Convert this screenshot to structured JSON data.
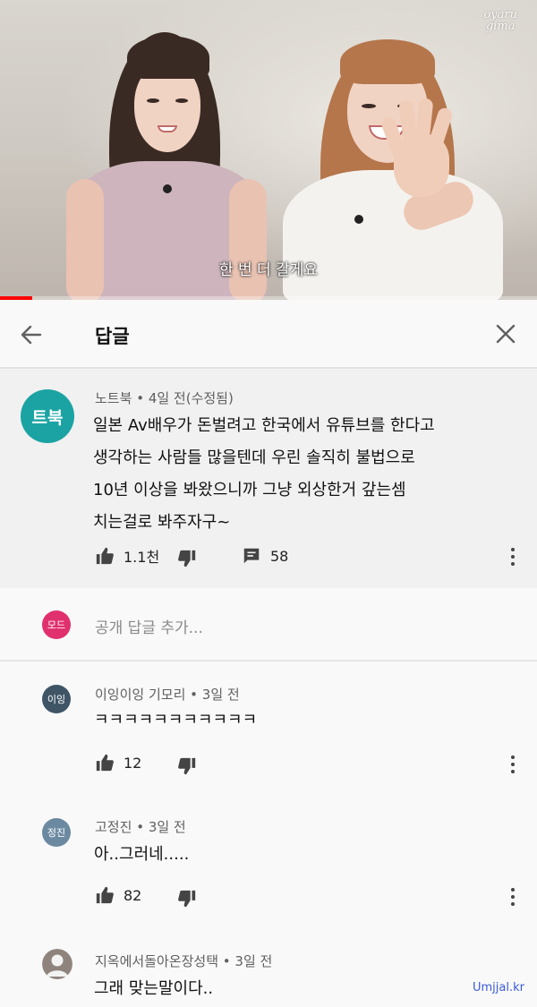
{
  "video": {
    "watermark_line1": "oyaru",
    "watermark_line2": "gima",
    "subtitle": "한 번 더 갈게요",
    "progress": 0.06
  },
  "header": {
    "title": "답글",
    "back_icon": "arrow-left-icon",
    "close_icon": "close-icon"
  },
  "parent_comment": {
    "avatar_text": "트북",
    "avatar_color": "#1ba3a3",
    "author": "노트북",
    "time": "4일 전(수정됨)",
    "lines": [
      "일본 Av배우가 돈벌려고 한국에서 유튜브를 한다고",
      "생각하는 사람들 많을텐데 우린 솔직히 불법으로",
      "10년 이상을 봐왔으니까 그냥 외상한거 갚는셈",
      "치는걸로 봐주자구~"
    ],
    "likes": "1.1천",
    "reply_count": "58"
  },
  "add_reply": {
    "avatar_text": "모드",
    "avatar_color": "#e0306e",
    "placeholder": "공개 답글 추가..."
  },
  "replies": [
    {
      "avatar_text": "이잉",
      "avatar_color": "#3f5566",
      "author": "이잉이잉 기모리",
      "time": "3일 전",
      "text": "ㅋㅋㅋㅋㅋㅋㅋㅋㅋㅋㅋ",
      "likes": "12"
    },
    {
      "avatar_text": "정진",
      "avatar_color": "#6b8aa1",
      "author": "고정진",
      "time": "3일 전",
      "text": "아..그러네.....",
      "likes": "82"
    },
    {
      "avatar_text": "",
      "avatar_color": "#9a8f88",
      "author": "지옥에서돌아온장성택",
      "time": "3일 전",
      "text": "그래 맞는말이다..",
      "likes": ""
    }
  ],
  "site_watermark": "Umjjal.kr"
}
